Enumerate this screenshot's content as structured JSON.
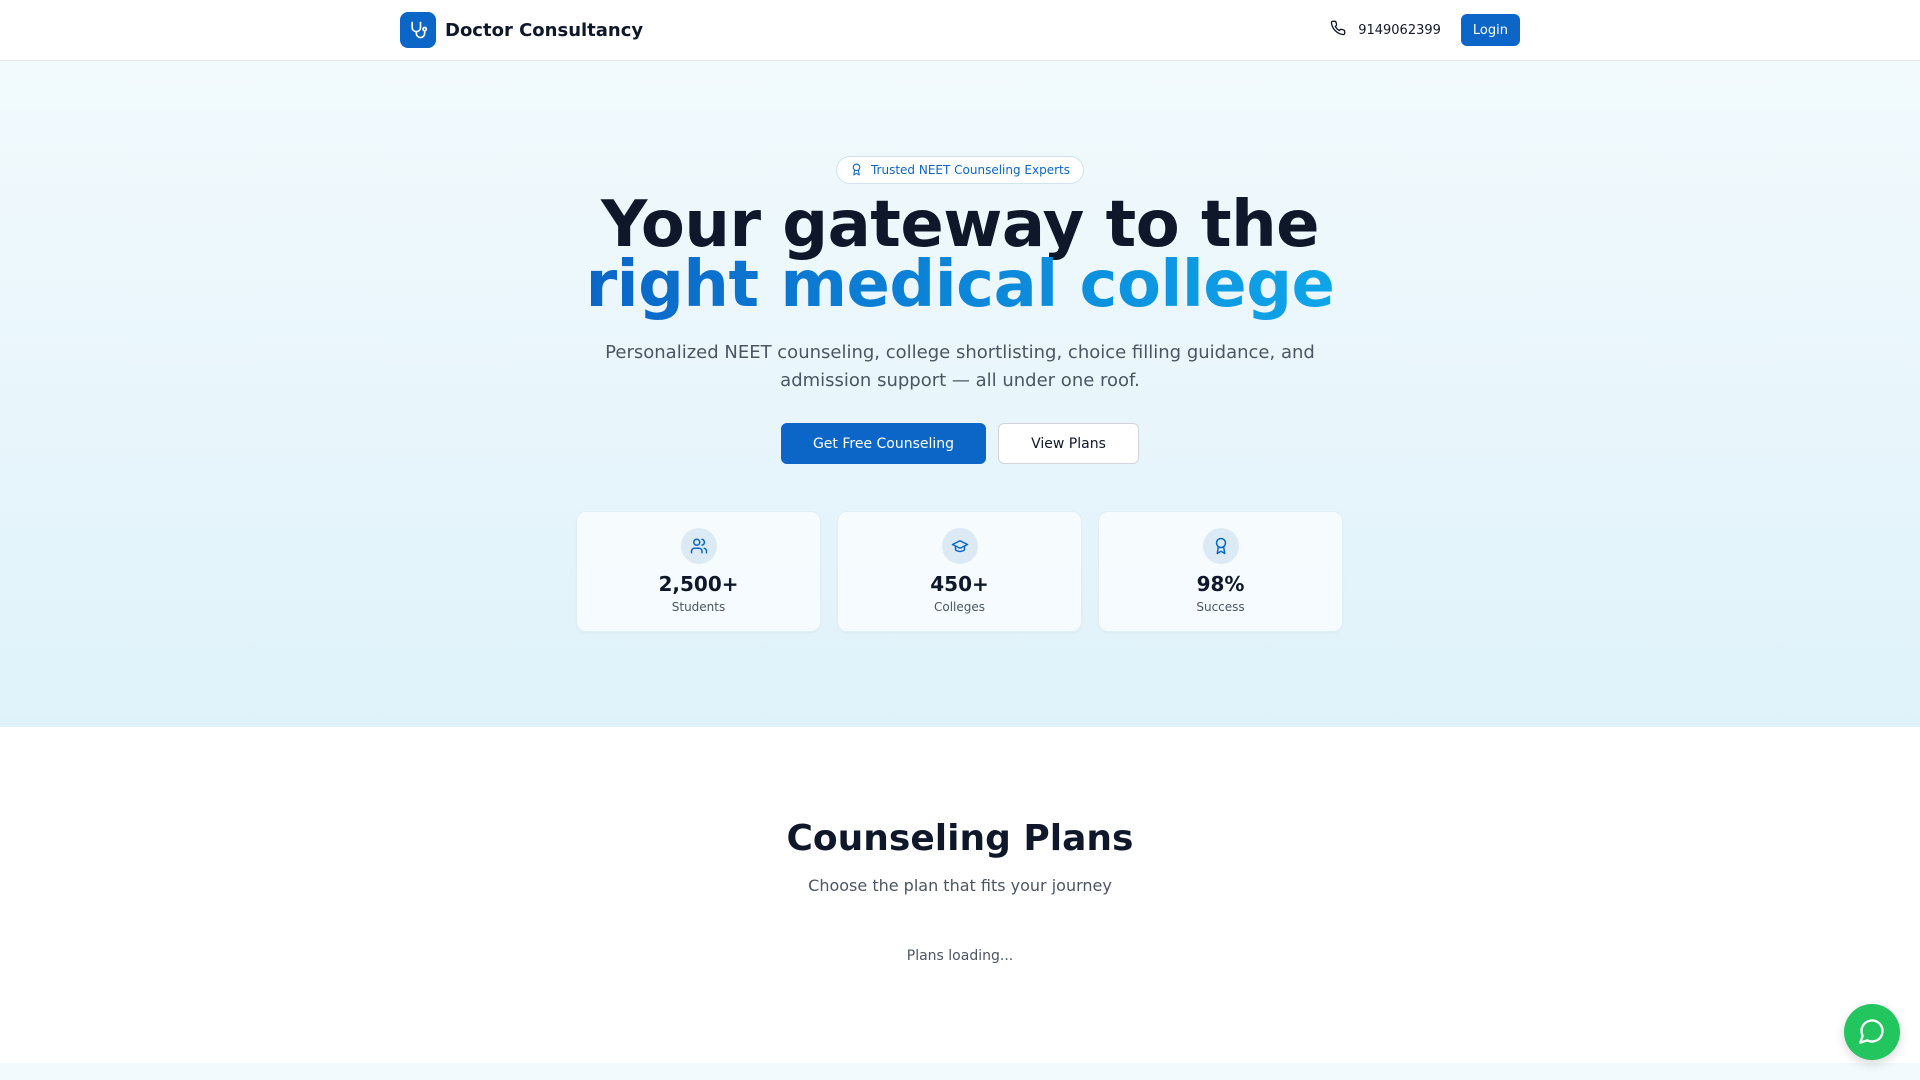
{
  "header": {
    "brand_name": "Doctor Consultancy",
    "brand_icon": "stethoscope-icon",
    "phone_icon": "phone-icon",
    "phone_number": "9149062399",
    "login_label": "Login"
  },
  "hero": {
    "badge_icon": "award-icon",
    "badge_text": "Trusted NEET Counseling Experts",
    "title_line1": "Your gateway to the",
    "title_line2": "right medical college",
    "subtitle": "Personalized NEET counseling, college shortlisting, choice filling guidance, and admission support — all under one roof.",
    "primary_cta": "Get Free Counseling",
    "secondary_cta": "View Plans",
    "stats": [
      {
        "icon": "users-icon",
        "value": "2,500+",
        "label": "Students"
      },
      {
        "icon": "graduation-cap-icon",
        "value": "450+",
        "label": "Colleges"
      },
      {
        "icon": "award-icon",
        "value": "98%",
        "label": "Success"
      }
    ]
  },
  "plans": {
    "title": "Counseling Plans",
    "subtitle": "Choose the plan that fits your journey",
    "loading_text": "Plans loading..."
  },
  "chat": {
    "icon": "chat-bubble-icon"
  },
  "colors": {
    "primary": "#0b66c8",
    "accent_gradient_end": "#0ea5e9",
    "chat_green": "#22c55e",
    "hero_bg": "#e6f5fb"
  }
}
